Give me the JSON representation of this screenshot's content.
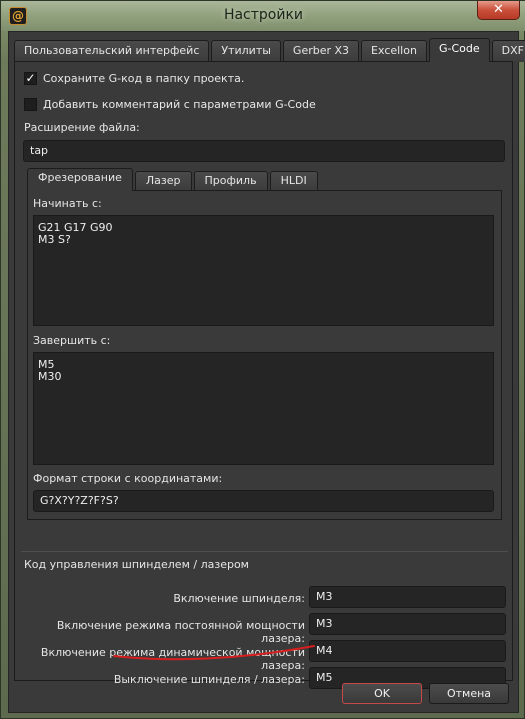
{
  "window": {
    "title": "Настройки",
    "close_glyph": "✕",
    "app_icon_glyph": "@"
  },
  "tabs": [
    {
      "label": "Пользовательский интерфейс",
      "active": false
    },
    {
      "label": "Утилиты",
      "active": false
    },
    {
      "label": "Gerber X3",
      "active": false
    },
    {
      "label": "Excellon",
      "active": false
    },
    {
      "label": "G-Code",
      "active": true
    },
    {
      "label": "DXF",
      "active": false
    }
  ],
  "gcode": {
    "save_to_project": {
      "label": "Сохраните G-код в папку проекта.",
      "checked": true,
      "glyph": "✓"
    },
    "add_comment": {
      "label": "Добавить комментарий с параметрами G-Code",
      "checked": false
    },
    "extension_label": "Расширение файла:",
    "extension_value": "tap",
    "subtabs": [
      {
        "label": "Фрезерование",
        "active": true
      },
      {
        "label": "Лазер",
        "active": false
      },
      {
        "label": "Профиль",
        "active": false
      },
      {
        "label": "HLDI",
        "active": false
      }
    ],
    "start_label": "Начинать с:",
    "start_code": "G21 G17 G90\nM3 S?",
    "end_label": "Завершить с:",
    "end_code": "M5\nM30",
    "coord_format_label": "Формат строки с координатами:",
    "coord_format_value": "G?X?Y?Z?F?S?",
    "spindle_group_title": "Код управления шпинделем / лазером",
    "spindle_rows": [
      {
        "label": "Включение шпинделя:",
        "value": "M3"
      },
      {
        "label": "Включение режима постоянной мощности лазера:",
        "value": "M3"
      },
      {
        "label": "Включение режима динамической мощности лазера:",
        "value": "M4"
      },
      {
        "label": "Выключение шпинделя / лазера:",
        "value": "M5"
      }
    ]
  },
  "buttons": {
    "ok": "OK",
    "cancel": "Отмена"
  },
  "colors": {
    "annotation_underline": "#d81e1e",
    "default_button_border": "#c44a4a"
  }
}
